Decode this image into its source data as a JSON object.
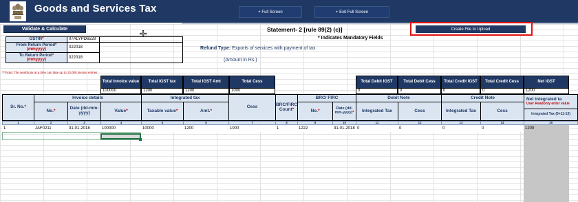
{
  "header": {
    "app_title": "Goods and Services Tax",
    "full_screen_label": "+ Full Screen",
    "exit_full_screen_label": "+ Exit Full Screen"
  },
  "toolbar": {
    "validate_label": "Validate & Calculate",
    "statement_title": "Statement- 2 [rule 89(2) (c)]",
    "create_file_label": "Create File to Upload",
    "mandatory_note": "* Indicates Mandatory Fields"
  },
  "form": {
    "gstin_label": "GSTIN",
    "gstin_value": "07ALYPD6528",
    "from_label": "From Return Period",
    "from_format": "(mmyyyy)",
    "from_value": "022018",
    "to_label": "To Return Period",
    "to_format": "(mmyyyy)",
    "to_value": "022018",
    "refund_type_label": "Refund Type:",
    "refund_type_value": "Exports of services with payment of tax",
    "amount_note": "(Amount in Rs.)",
    "warning_note": "***Note: The workbook at a time can take up to 10,000 invoice entries"
  },
  "totals": {
    "headers": [
      "Total Invoice value",
      "Total IGST tax",
      "Total IGST Amt",
      "Total Cess",
      "Total Debit IGST",
      "Total Debit Cess",
      "Total Credit IGST",
      "Total Credit Cess",
      "Net IGST"
    ],
    "values": [
      "100000",
      "1200",
      "1200",
      "1000",
      "0",
      "0",
      "0",
      "0",
      "1200"
    ]
  },
  "table": {
    "group_headers": {
      "invoice_details": "Invoice details",
      "integrated_tax": "Integrated tax",
      "cess": "Cess",
      "brc_frc_count": "BRC/FIRC Count",
      "brc_firc": "BRC/ FIRC",
      "debit_note": "Debit Note",
      "credit_note": "Credit Note",
      "net_integrated": "Net Integrated ta",
      "net_integrated_note": "User Readonly enter value"
    },
    "sub_headers": {
      "sr_no": "Sr. No.",
      "no": "No.",
      "date": "Date (dd-mm-yyyy)",
      "value": "Value",
      "taxable_value": "Taxable value",
      "amt": "Amt.",
      "brc_no": "No.",
      "brc_date": "Date (dd-mm-yyyy)",
      "debit_integrated_tax": "Integrated Tax",
      "debit_cess": "Cess",
      "credit_integrated_tax": "Integrated Tax",
      "credit_cess": "Cess",
      "net_formula": "Integrated Tax (6+11-13)"
    },
    "column_numbers": [
      "1",
      "2",
      "3",
      "4",
      "5",
      "6",
      "7",
      "8",
      "9",
      "10",
      "11",
      "12",
      "13",
      "14",
      "15"
    ],
    "rows": [
      [
        "1",
        "JAF0211",
        "31-01-2018",
        "100000",
        "10000",
        "1200",
        "1000",
        "1",
        "1222",
        "31-01-2018",
        "0",
        "0",
        "0",
        "0",
        "1200"
      ]
    ]
  }
}
